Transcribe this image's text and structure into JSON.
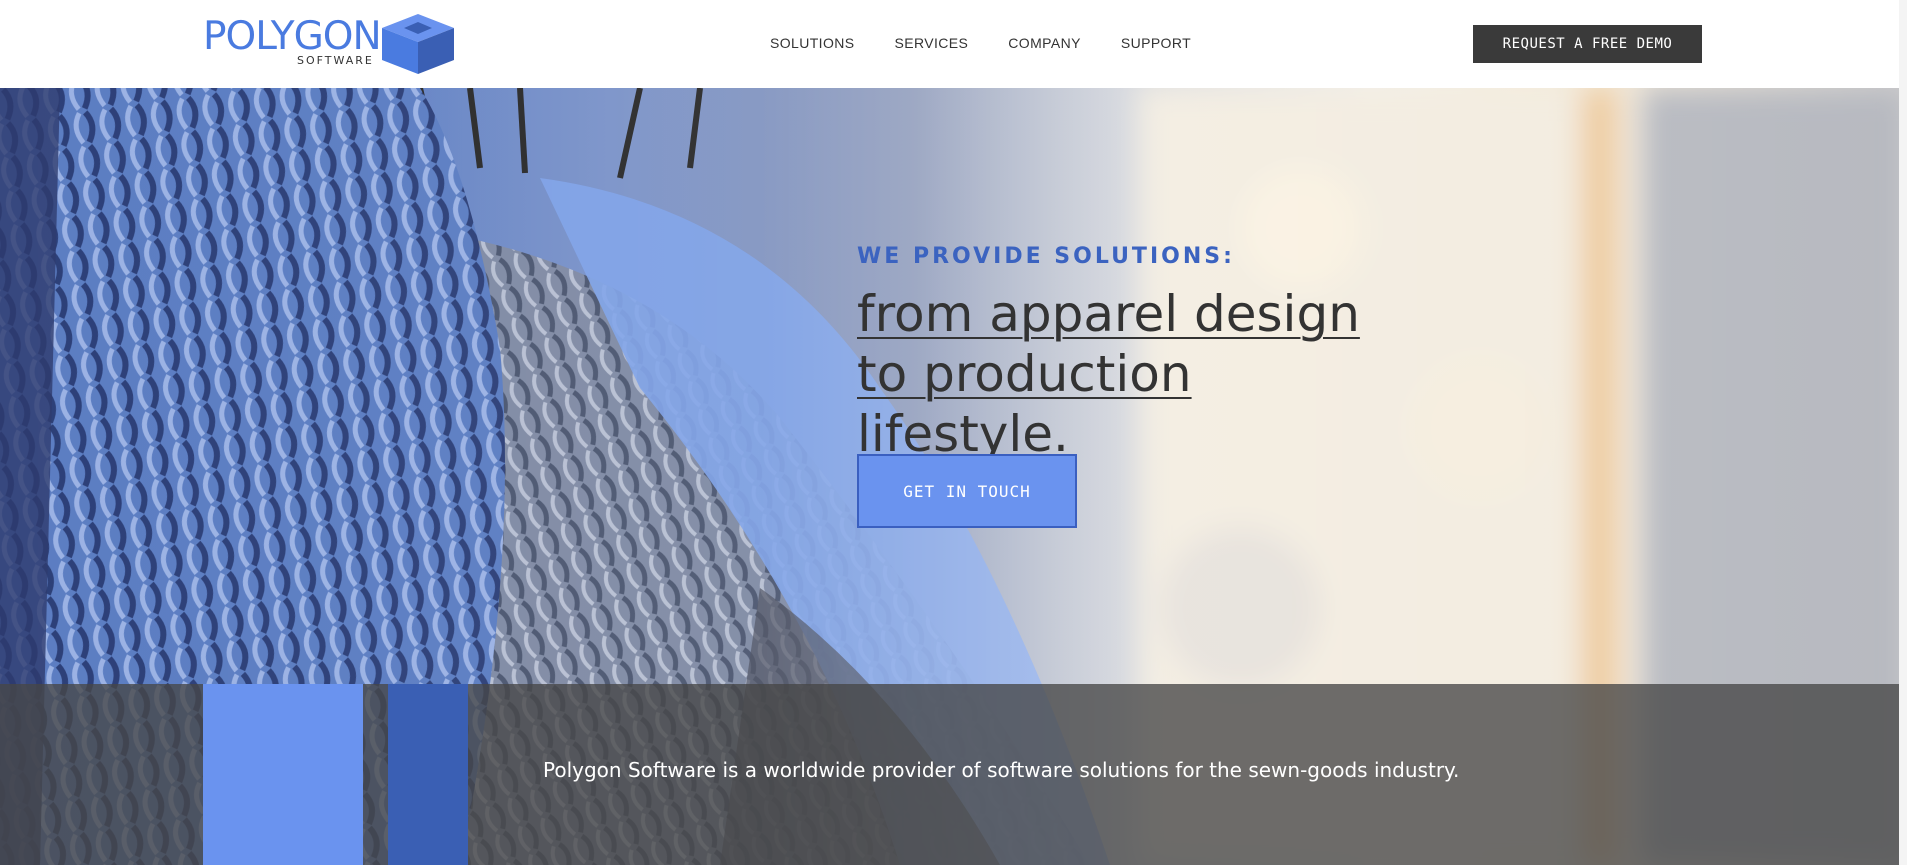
{
  "header": {
    "logo": {
      "word": "POLYGON",
      "sub": "SOFTWARE"
    },
    "nav": [
      "SOLUTIONS",
      "SERVICES",
      "COMPANY",
      "SUPPORT"
    ],
    "demo_button": "REQUEST A FREE DEMO"
  },
  "hero": {
    "eyebrow": "WE PROVIDE SOLUTIONS:",
    "headline": "from apparel design to production lifestyle.",
    "cta": "GET IN TOUCH"
  },
  "band": {
    "text": "Polygon Software is a worldwide provider of software solutions for the sewn-goods industry."
  },
  "colors": {
    "brand_blue": "#4a7be0",
    "accent_blue": "#6a93ef",
    "deep_blue": "#3a5fb4",
    "dark_button": "#3a3a3a"
  }
}
